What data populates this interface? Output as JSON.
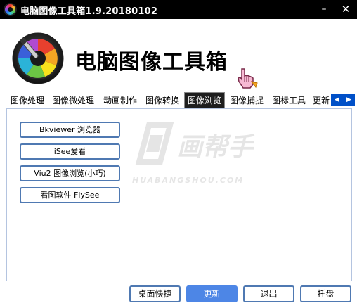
{
  "window": {
    "title": "电脑图像工具箱1.9.20180102",
    "minimize_glyph": "–",
    "close_glyph": "✕"
  },
  "header": {
    "title": "电脑图像工具箱"
  },
  "tabs": [
    {
      "label": "图像处理"
    },
    {
      "label": "图像微处理"
    },
    {
      "label": "动画制作"
    },
    {
      "label": "图像转换"
    },
    {
      "label": "图像浏览",
      "active": true
    },
    {
      "label": "图像捕捉"
    },
    {
      "label": "图标工具"
    },
    {
      "label": "更新"
    }
  ],
  "tab_nav": {
    "prev": "◀",
    "next": "▶"
  },
  "tools": [
    {
      "label": "Bkviewer 浏览器"
    },
    {
      "label": "iSee爱看"
    },
    {
      "label": "Viu2 图像浏览(小巧)"
    },
    {
      "label": "看图软件 FlySee"
    }
  ],
  "watermark": {
    "main": "画帮手",
    "sub": "HUABANGSHOU.COM"
  },
  "bottom_buttons": {
    "desktop_shortcut": "桌面快捷",
    "update": "更新",
    "exit": "退出",
    "tray": "托盘"
  },
  "colors": {
    "titlebar": "#000000",
    "button_border": "#4f79b2",
    "primary_button": "#4d86e6",
    "tab_nav": "#0050c8"
  }
}
